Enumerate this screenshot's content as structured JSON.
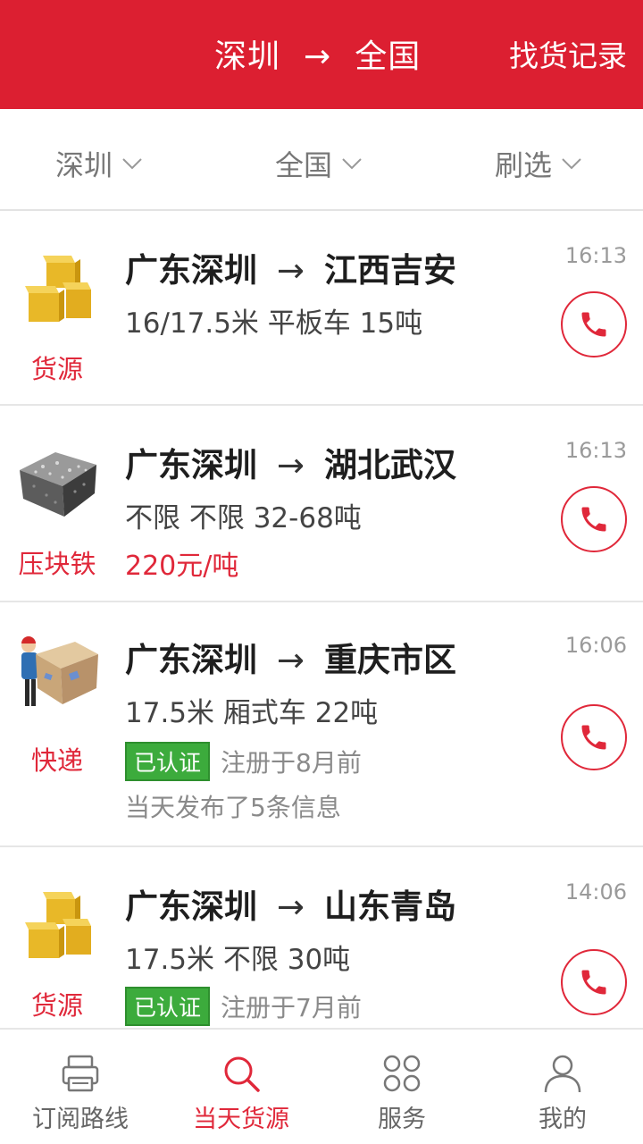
{
  "header": {
    "from": "深圳",
    "arrow": "→",
    "to": "全国",
    "record_link": "找货记录"
  },
  "filters": [
    {
      "label": "深圳"
    },
    {
      "label": "全国"
    },
    {
      "label": "刷选"
    }
  ],
  "listings": [
    {
      "category": "货源",
      "thumb": "boxes-icon",
      "from": "广东深圳",
      "to": "江西吉安",
      "spec": "16/17.5米 平板车 15吨",
      "time": "16:13"
    },
    {
      "category": "压块铁",
      "thumb": "scrap-block-icon",
      "from": "广东深圳",
      "to": "湖北武汉",
      "spec": "不限 不限 32-68吨",
      "price": "220元/吨",
      "time": "16:13"
    },
    {
      "category": "快递",
      "thumb": "courier-icon",
      "from": "广东深圳",
      "to": "重庆市区",
      "spec": "17.5米 厢式车 22吨",
      "badge": "已认证",
      "registered": "注册于8月前",
      "note": "当天发布了5条信息",
      "time": "16:06"
    },
    {
      "category": "货源",
      "thumb": "boxes-icon",
      "from": "广东深圳",
      "to": "山东青岛",
      "spec": "17.5米 不限 30吨",
      "badge": "已认证",
      "registered": "注册于7月前",
      "time": "14:06"
    }
  ],
  "route_arrow": "→",
  "tabs": [
    {
      "label": "订阅路线",
      "icon": "printer-icon",
      "active": false
    },
    {
      "label": "当天货源",
      "icon": "search-icon",
      "active": true
    },
    {
      "label": "服务",
      "icon": "grid-icon",
      "active": false
    },
    {
      "label": "我的",
      "icon": "user-icon",
      "active": false
    }
  ],
  "colors": {
    "brand": "#dc1f31",
    "accent": "#e0283a",
    "verified": "#3cab3c"
  }
}
